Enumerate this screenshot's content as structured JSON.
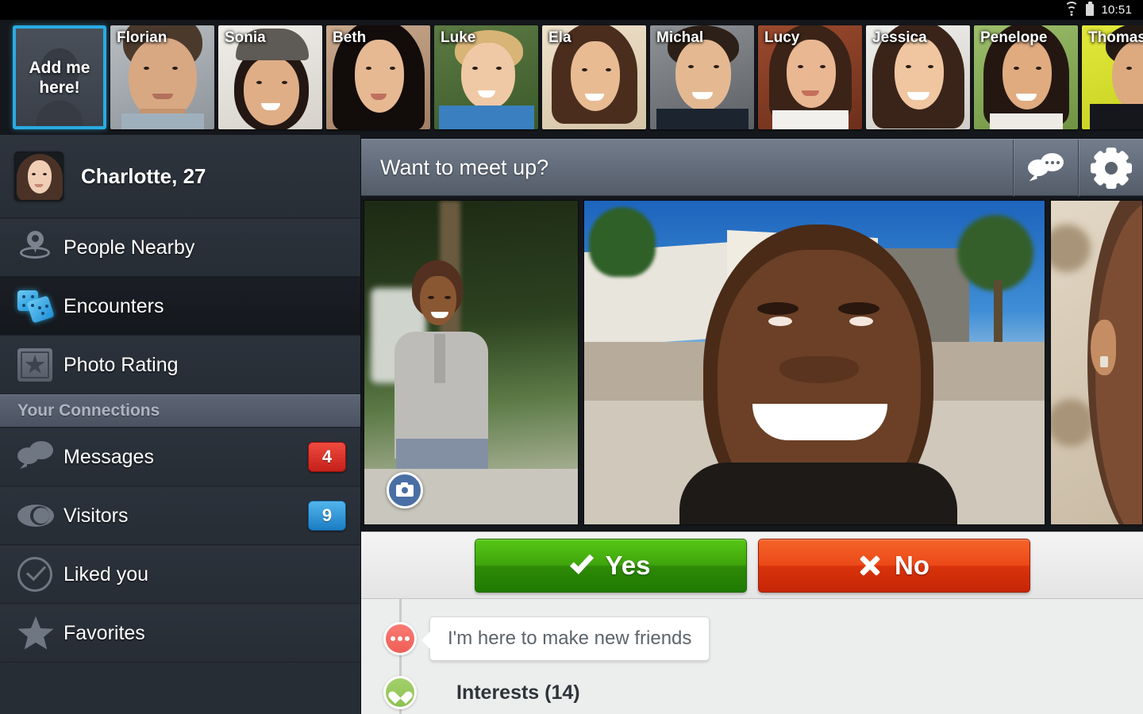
{
  "status_bar": {
    "time": "10:51",
    "wifi_icon": "wifi-icon",
    "battery_icon": "battery-icon"
  },
  "top_strip": {
    "add_tile": {
      "line1": "Add me",
      "line2": "here!",
      "accent": "#29ABE2"
    },
    "people": [
      {
        "name": "Florian"
      },
      {
        "name": "Sonia"
      },
      {
        "name": "Beth"
      },
      {
        "name": "Luke"
      },
      {
        "name": "Ela"
      },
      {
        "name": "Michal"
      },
      {
        "name": "Lucy"
      },
      {
        "name": "Jessica"
      },
      {
        "name": "Penelope"
      },
      {
        "name": "Thomas"
      }
    ]
  },
  "sidebar": {
    "profile": {
      "name_age": "Charlotte, 27",
      "avatar_icon": "user-avatar"
    },
    "items": [
      {
        "label": "People Nearby",
        "icon": "location-pin-icon",
        "badge": "",
        "active": false
      },
      {
        "label": "Encounters",
        "icon": "dice-icon",
        "badge": "",
        "active": true
      },
      {
        "label": "Photo Rating",
        "icon": "star-frame-icon",
        "badge": "",
        "active": false
      }
    ],
    "section_header": "Your Connections",
    "connection_items": [
      {
        "label": "Messages",
        "icon": "chat-bubbles-icon",
        "badge": "4",
        "badge_color": "#d42a20"
      },
      {
        "label": "Visitors",
        "icon": "eye-icon",
        "badge": "9",
        "badge_color": "#2288cc"
      },
      {
        "label": "Liked you",
        "icon": "check-circle-icon",
        "badge": ""
      },
      {
        "label": "Favorites",
        "icon": "star-icon",
        "badge": ""
      }
    ]
  },
  "main": {
    "header": {
      "title": "Want to meet up?",
      "chat_icon": "chat-bubbles-icon",
      "settings_icon": "gear-icon"
    },
    "photos": [
      {
        "camera_badge": "camera-icon"
      },
      {
        "camera_badge": ""
      },
      {
        "camera_badge": ""
      }
    ],
    "actions": {
      "yes_label": "Yes",
      "yes_icon": "check-icon",
      "yes_color": "#2e8a06",
      "no_label": "No",
      "no_icon": "cross-icon",
      "no_color": "#d8330c"
    },
    "timeline": [
      {
        "icon": "dots-icon",
        "bubble_text": "I'm here to make new friends"
      },
      {
        "icon": "heart-icon",
        "label": "Interests (14)"
      }
    ]
  }
}
